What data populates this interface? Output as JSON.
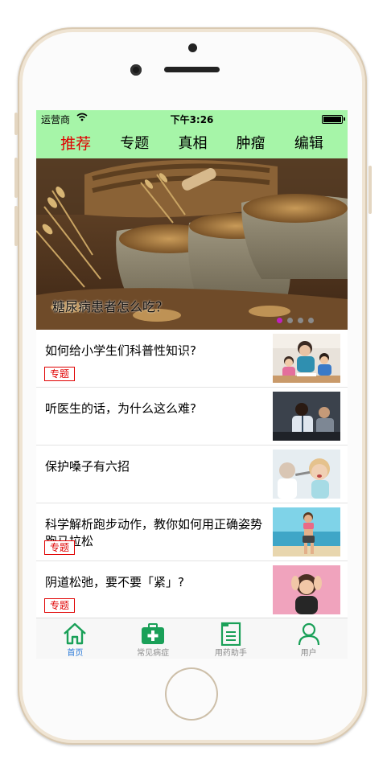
{
  "status_bar": {
    "carrier": "运营商",
    "time": "下午3:26"
  },
  "tabs": [
    {
      "label": "推荐",
      "active": true
    },
    {
      "label": "专题"
    },
    {
      "label": "真相"
    },
    {
      "label": "肿瘤"
    },
    {
      "label": "编辑"
    }
  ],
  "banner": {
    "caption": "糖尿病患者怎么吃？",
    "page_count": 4,
    "active_page": 1,
    "active_dot_color": "#c020c0"
  },
  "articles": [
    {
      "title": "如何给小学生们科普性知识?",
      "tag": "专题",
      "thumb": "mother-children-studying"
    },
    {
      "title": "听医生的话，为什么这么难?",
      "tag": "",
      "thumb": "doctor-patient-consult"
    },
    {
      "title": "保护嗓子有六招",
      "tag": "",
      "thumb": "woman-throat-exam"
    },
    {
      "title": "科学解析跑步动作，教你如何用正确姿势跑马拉松",
      "tag": "专题",
      "thumb": "woman-runner-beach"
    },
    {
      "title": "阴道松弛，要不要「紧」?",
      "tag": "专题",
      "thumb": "stressed-woman"
    }
  ],
  "bottom_nav": [
    {
      "label": "首页",
      "icon": "home-icon",
      "active": true
    },
    {
      "label": "常见病症",
      "icon": "medical-kit-icon"
    },
    {
      "label": "用药助手",
      "icon": "document-list-icon"
    },
    {
      "label": "用户",
      "icon": "user-icon"
    }
  ],
  "colors": {
    "header_bg": "#a6f5a8",
    "active_tab": "#e00000",
    "nav_green": "#1aa058",
    "nav_active_label": "#2b7ad8"
  }
}
